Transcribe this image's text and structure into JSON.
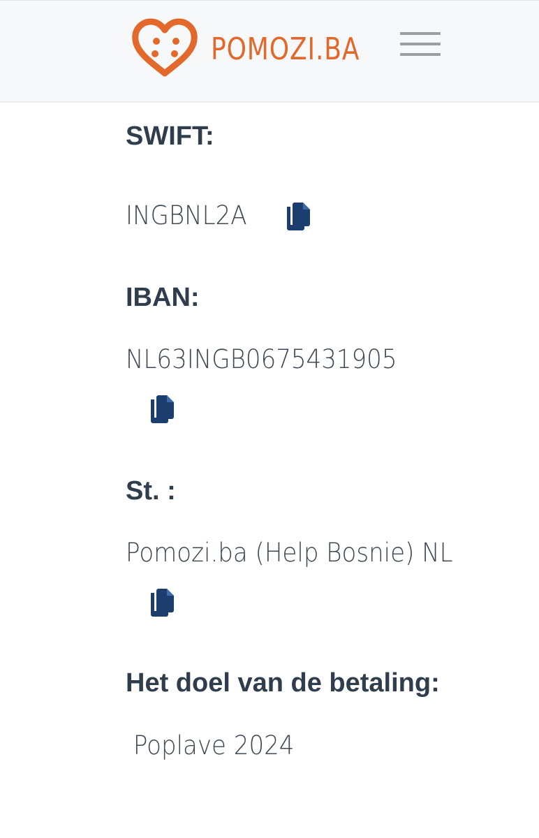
{
  "header": {
    "brand_name": "POMOZI.BA",
    "brand_color": "#e2692b"
  },
  "fields": [
    {
      "label": "SWIFT:",
      "value": "INGBNL2A",
      "copy_icon": "copy-icon"
    },
    {
      "label": "IBAN:",
      "value": "NL63INGB0675431905",
      "copy_icon": "copy-icon"
    },
    {
      "label": "St. :",
      "value": "Pomozi.ba (Help Bosnie) NL",
      "copy_icon": "copy-icon"
    },
    {
      "label": "Het doel van de betaling:",
      "value": " Poplave 2024"
    }
  ],
  "colors": {
    "label": "#2f3d4c",
    "value": "#3e4853",
    "icon": "#1c3e6e",
    "header_bg": "#f7f8f9",
    "menu_icon": "#9b9da1"
  }
}
